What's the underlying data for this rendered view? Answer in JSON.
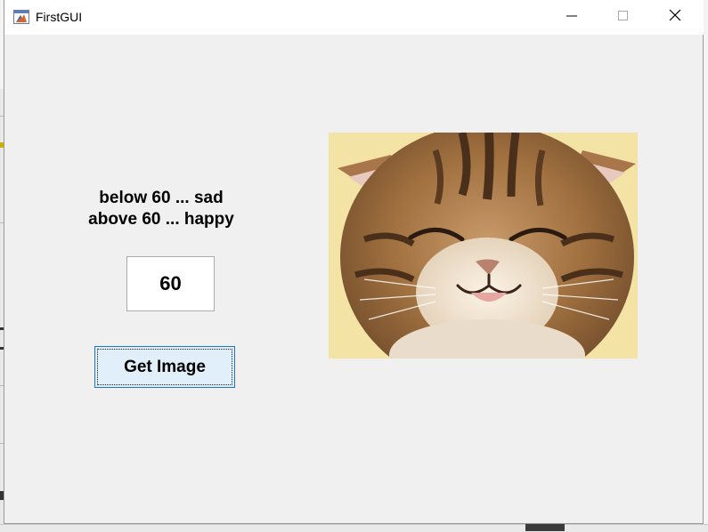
{
  "window": {
    "title": "FirstGUI"
  },
  "titlebar_buttons": {
    "minimize": "minimize-icon",
    "maximize": "maximize-icon",
    "close": "close-icon"
  },
  "content": {
    "instruction_line1": "below 60 ... sad",
    "instruction_line2": "above 60 ... happy",
    "value": "60",
    "button_label": "Get Image",
    "image_description_icon": "smiling-kitten-image"
  },
  "colors": {
    "window_bg": "#f0f0f0",
    "button_bg": "#e1effb",
    "button_border": "#1e74c8",
    "image_bg": "#f3e3a4"
  }
}
